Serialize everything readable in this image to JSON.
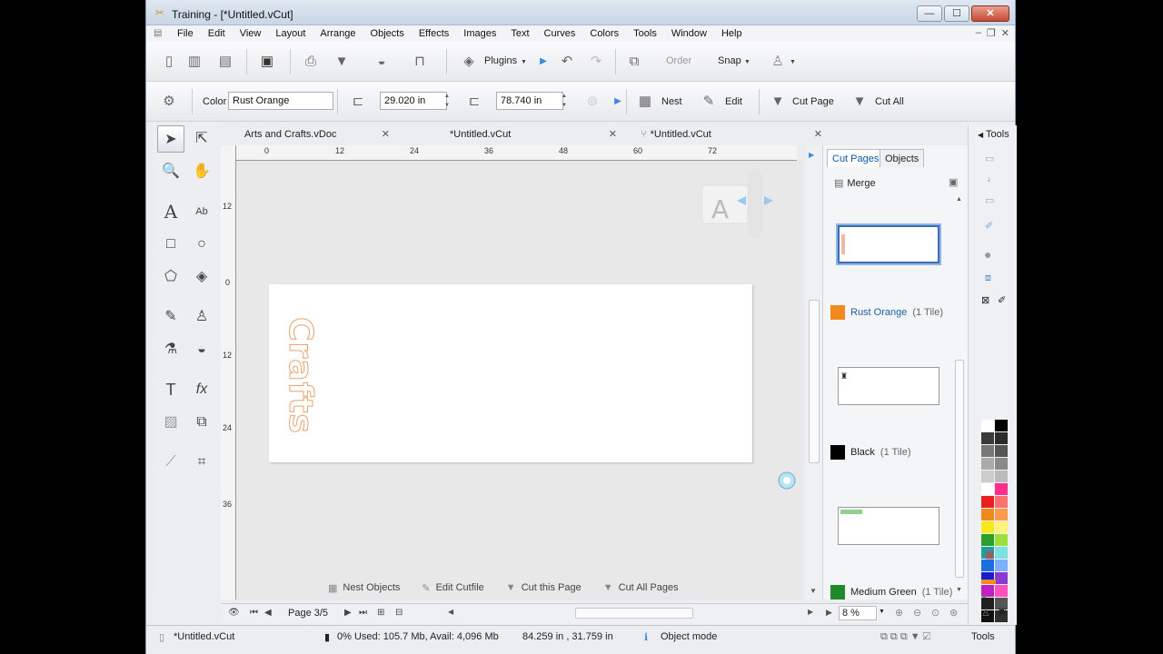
{
  "window": {
    "title": "Training - [*Untitled.vCut]",
    "minimize": "—",
    "maximize": "☐",
    "close": "✕"
  },
  "menu": [
    "File",
    "Edit",
    "View",
    "Layout",
    "Arrange",
    "Objects",
    "Effects",
    "Images",
    "Text",
    "Curves",
    "Colors",
    "Tools",
    "Window",
    "Help"
  ],
  "toolbar1": {
    "plugins_label": "Plugins",
    "order_label": "Order",
    "snap_label": "Snap"
  },
  "toolbar2": {
    "color_label": "Color",
    "color_value": "Rust Orange",
    "width_value": "29.020 in",
    "height_value": "78.740 in",
    "nest_label": "Nest",
    "edit_label": "Edit",
    "cut_page_label": "Cut Page",
    "cut_all_label": "Cut All"
  },
  "tabs": [
    {
      "label": "Arts and Crafts.vDoc"
    },
    {
      "label": "*Untitled.vCut"
    },
    {
      "label": "*Untitled.vCut"
    }
  ],
  "ruler_h": [
    "0",
    "12",
    "24",
    "36",
    "48",
    "60",
    "72"
  ],
  "ruler_v": [
    "12",
    "0",
    "12",
    "24",
    "36"
  ],
  "canvas": {
    "page_text": "Crafts",
    "overlay_letter": "A"
  },
  "canvas_actions": {
    "nest_objects": "Nest Objects",
    "edit_cutfile": "Edit Cutfile",
    "cut_this_page": "Cut this Page",
    "cut_all_pages": "Cut All Pages"
  },
  "page_nav": {
    "page_label": "Page 3/5"
  },
  "panel": {
    "tab_cut_pages": "Cut Pages",
    "tab_objects": "Objects",
    "merge_label": "Merge",
    "zoom": "8 %",
    "entries": [
      {
        "name": "Rust Orange",
        "tiles": "(1 Tile)",
        "color": "#f08a1c",
        "name_color": "#1c5fae"
      },
      {
        "name": "Black",
        "tiles": "(1 Tile)",
        "color": "#000000",
        "name_color": "#222222"
      },
      {
        "name": "Medium Green",
        "tiles": "(1 Tile)",
        "color": "#1f8a2a",
        "name_color": "#222222"
      }
    ]
  },
  "tools_strip": {
    "label": "Tools",
    "palette": [
      "#ffffff",
      "#000000",
      "#3a3a3a",
      "#2a2a2a",
      "#777777",
      "#555555",
      "#aaaaaa",
      "#8a8a8a",
      "#cccccc",
      "#bbbbbb",
      "#ffffff",
      "#ff2e8a",
      "#e82020",
      "#ff7070",
      "#f08a1c",
      "#ff9a4a",
      "#f6e81a",
      "#fff27a",
      "#2aa02a",
      "#9adf3a",
      "#1fa0a0",
      "#7ae0e0",
      "#1a70e0",
      "#7ab0ff",
      "#1a1acf",
      "#8a3acf",
      "#c020c0",
      "#ff50c0",
      "#202020",
      "#555555",
      "#101010",
      "#303030"
    ]
  },
  "status": {
    "doc": "*Untitled.vCut",
    "memory": "0%  Used: 105.7 Mb, Avail: 4,096 Mb",
    "coords": "84.259 in , 31.759 in",
    "mode": "Object mode",
    "tools": "Tools"
  }
}
